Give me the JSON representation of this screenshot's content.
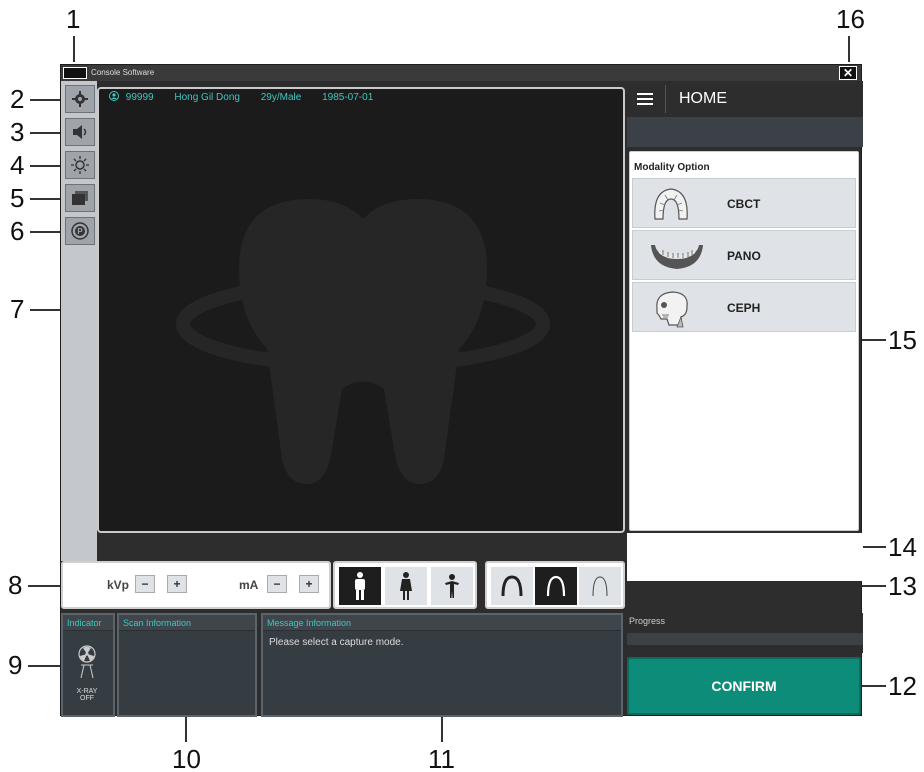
{
  "callouts": [
    "1",
    "2",
    "3",
    "4",
    "5",
    "6",
    "7",
    "8",
    "9",
    "10",
    "11",
    "12",
    "13",
    "14",
    "15",
    "16"
  ],
  "app": {
    "title": "Console Software",
    "close_glyph": "✕"
  },
  "patient": {
    "id": "99999",
    "name": "Hong Gil Dong",
    "age_sex": "29y/Male",
    "dob": "1985-07-01"
  },
  "home": {
    "title": "HOME"
  },
  "modality": {
    "header": "Modality Option",
    "options": [
      {
        "label": "CBCT",
        "icon": "cbct-arch-icon"
      },
      {
        "label": "PANO",
        "icon": "pano-jaw-icon"
      },
      {
        "label": "CEPH",
        "icon": "ceph-skull-icon"
      }
    ]
  },
  "controls": {
    "kvp_label": "kVp",
    "ma_label": "mA",
    "minus": "−",
    "plus": "+"
  },
  "panels": {
    "indicator": "Indicator",
    "xray_status": "X-RAY OFF",
    "scan_info": "Scan Information",
    "message_info": "Message Information",
    "message_text": "Please select a capture mode.",
    "progress": "Progress"
  },
  "confirm_label": "CONFIRM",
  "colors": {
    "accent": "#3fc7c0",
    "confirm": "#0e8c7a"
  }
}
